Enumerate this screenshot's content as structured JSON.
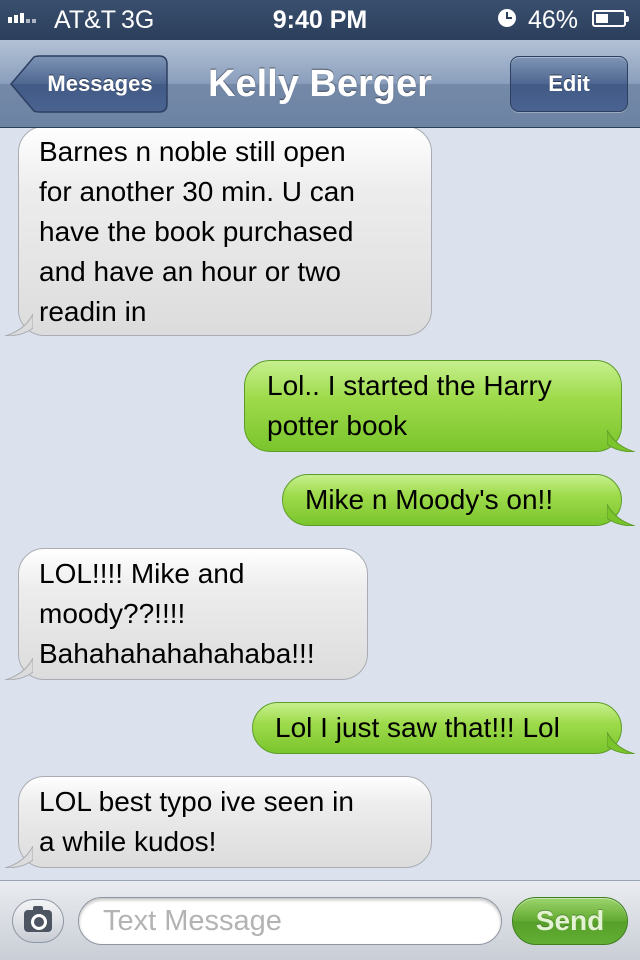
{
  "status_bar": {
    "carrier": "AT&T",
    "network": "3G",
    "time": "9:40 PM",
    "alarm_icon": "alarm-icon",
    "battery_percent": "46%",
    "battery_level": 0.46
  },
  "nav": {
    "back_label": "Messages",
    "title": "Kelly Berger",
    "edit_label": "Edit"
  },
  "messages": [
    {
      "direction": "in",
      "lines": [
        "Barnes n noble still open",
        "for another 30 min. U can",
        "have the book purchased",
        "and have an hour or two",
        "readin in"
      ]
    },
    {
      "direction": "out",
      "lines": [
        "Lol.. I started the Harry",
        "potter book"
      ]
    },
    {
      "direction": "out",
      "lines": [
        "Mike n Moody's on!!"
      ]
    },
    {
      "direction": "in",
      "lines": [
        "LOL!!!! Mike and",
        "moody??!!!!",
        "Bahahahahahahaba!!!"
      ]
    },
    {
      "direction": "out",
      "lines": [
        "Lol I just saw that!!! Lol"
      ]
    },
    {
      "direction": "in",
      "lines": [
        "LOL best typo ive seen in",
        "a while kudos!"
      ]
    }
  ],
  "input_bar": {
    "camera_icon": "camera-icon",
    "placeholder": "Text Message",
    "value": "",
    "send_label": "Send"
  },
  "colors": {
    "incoming_bubble": "#dcdcdc",
    "outgoing_bubble": "#7ac52c",
    "background": "#dbe2ed",
    "nav_bar": "#6d83a3"
  }
}
